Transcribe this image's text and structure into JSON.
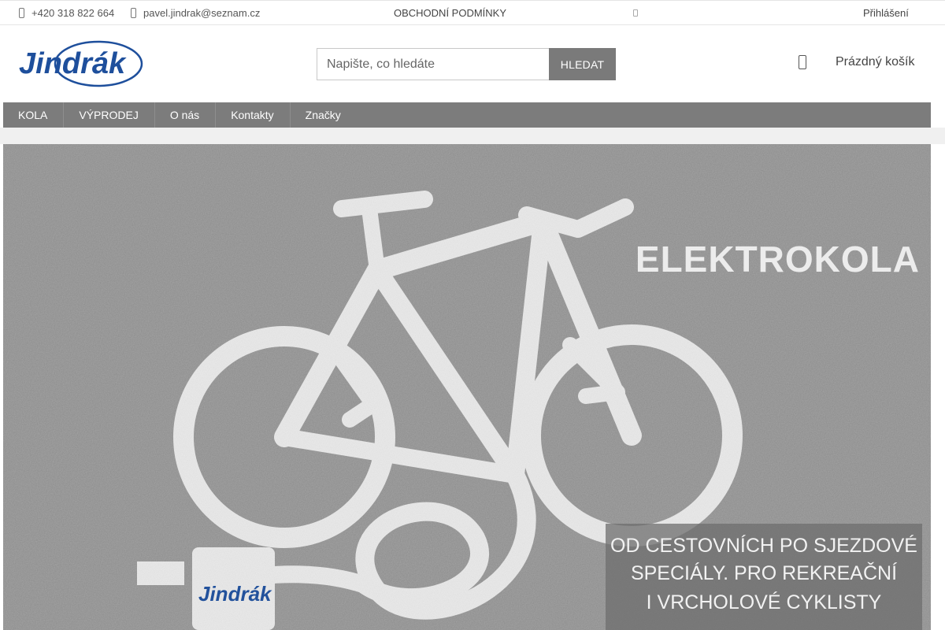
{
  "topbar": {
    "phone": "+420 318 822 664",
    "email": "pavel.jindrak@seznam.cz",
    "terms_link": "OBCHODNÍ PODMÍNKY",
    "login_link": "Přihlášení",
    "icons": [
      "phone-icon",
      "mail-icon",
      "social-icon"
    ]
  },
  "header": {
    "logo_text": "Jindrák",
    "search": {
      "placeholder": "Napište, co hledáte",
      "value": "",
      "button_label": "HLEDAT"
    },
    "cart_label": "Prázdný košík",
    "cart_icon": "cart-icon"
  },
  "nav": {
    "items": [
      {
        "label": "KOLA"
      },
      {
        "label": "VÝPRODEJ"
      },
      {
        "label": "O nás"
      },
      {
        "label": "Kontakty"
      },
      {
        "label": "Značky"
      }
    ]
  },
  "banner": {
    "headline": "ELEKTROKOLA",
    "tagline_line1": "OD CESTOVNÍCH PO SJEZDOVÉ",
    "tagline_line2": "SPECIÁLY. PRO REKREAČNÍ",
    "tagline_line3": "I VRCHOLOVÉ CYKLISTY",
    "stamp_logo_text": "Jindrák"
  },
  "colors": {
    "brand_blue": "#1e4f9c",
    "nav_bg": "#7c7c7c",
    "search_button_bg": "#7a7a7a",
    "banner_asphalt": "#8a8a8a"
  }
}
